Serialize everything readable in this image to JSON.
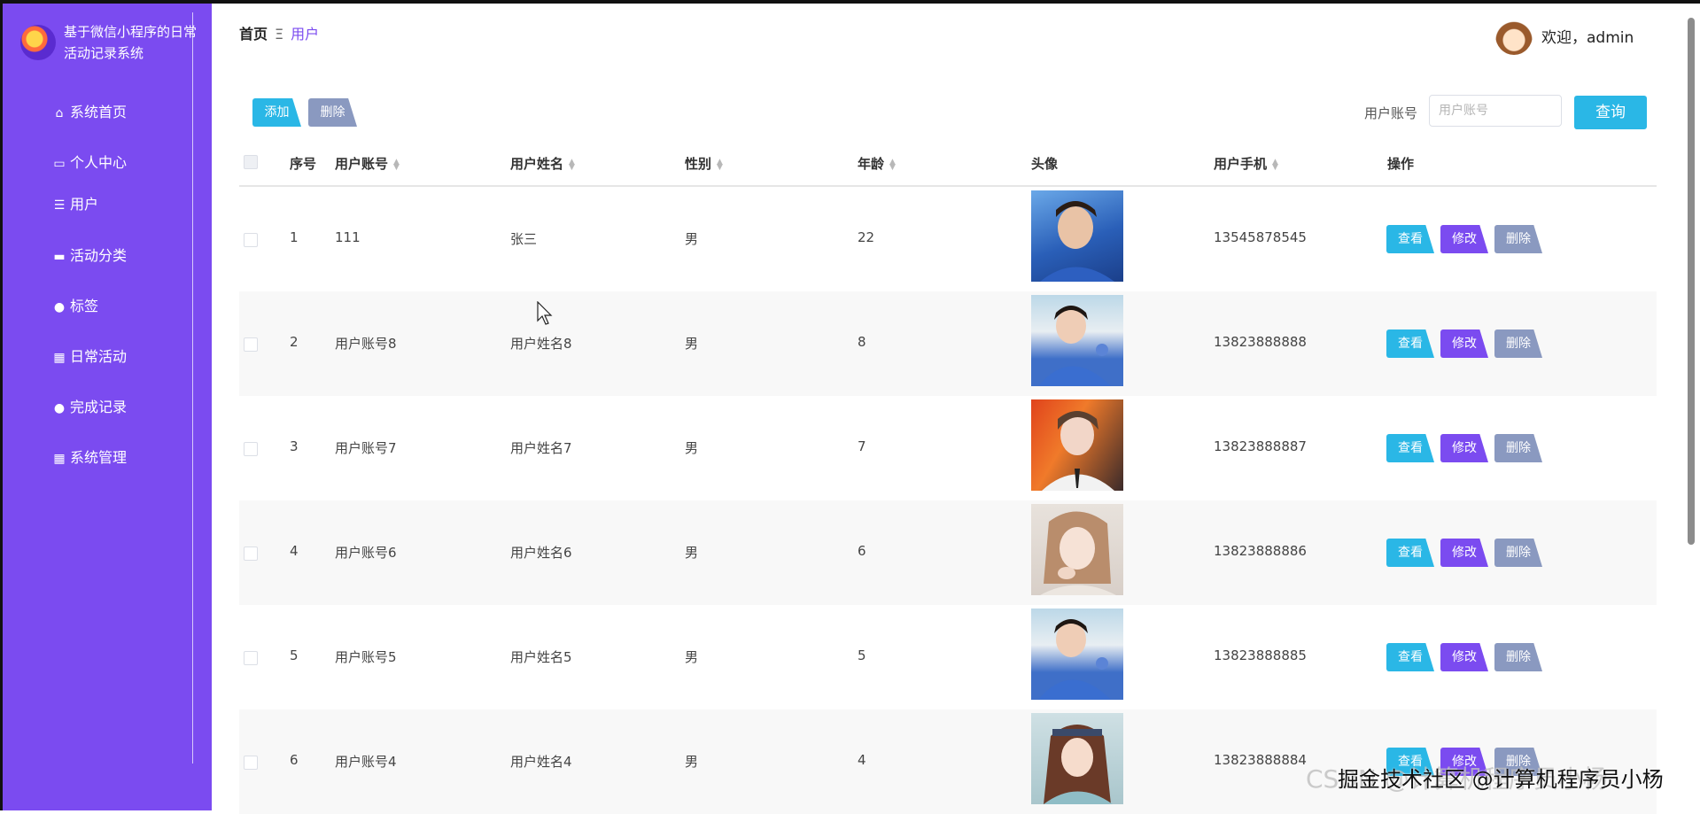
{
  "brand": {
    "title": "基于微信小程序的日常活动记录系统"
  },
  "sidebar": {
    "items": [
      {
        "label": "系统首页",
        "icon": "home-icon"
      },
      {
        "label": "个人中心",
        "icon": "card-icon"
      },
      {
        "label": "用户",
        "icon": "list-icon"
      },
      {
        "label": "活动分类",
        "icon": "monitor-icon"
      },
      {
        "label": "标签",
        "icon": "person-icon"
      },
      {
        "label": "日常活动",
        "icon": "grid-icon"
      },
      {
        "label": "完成记录",
        "icon": "user-icon"
      },
      {
        "label": "系统管理",
        "icon": "grid-icon"
      }
    ]
  },
  "breadcrumb": {
    "home": "首页",
    "sep": "Ξ",
    "current": "用户"
  },
  "header": {
    "welcome": "欢迎，admin"
  },
  "toolbar": {
    "add": "添加",
    "delete": "删除",
    "search_label": "用户账号",
    "search_placeholder": "用户账号",
    "search_button": "查询"
  },
  "table": {
    "headers": {
      "index": "序号",
      "account": "用户账号",
      "name": "用户姓名",
      "gender": "性别",
      "age": "年龄",
      "avatar": "头像",
      "phone": "用户手机",
      "ops": "操作"
    },
    "actions": {
      "view": "查看",
      "edit": "修改",
      "delete": "删除"
    },
    "rows": [
      {
        "index": "1",
        "account": "111",
        "name": "张三",
        "gender": "男",
        "age": "22",
        "phone": "13545878545"
      },
      {
        "index": "2",
        "account": "用户账号8",
        "name": "用户姓名8",
        "gender": "男",
        "age": "8",
        "phone": "13823888888"
      },
      {
        "index": "3",
        "account": "用户账号7",
        "name": "用户姓名7",
        "gender": "男",
        "age": "7",
        "phone": "13823888887"
      },
      {
        "index": "4",
        "account": "用户账号6",
        "name": "用户姓名6",
        "gender": "男",
        "age": "6",
        "phone": "13823888886"
      },
      {
        "index": "5",
        "account": "用户账号5",
        "name": "用户姓名5",
        "gender": "男",
        "age": "5",
        "phone": "13823888885"
      },
      {
        "index": "6",
        "account": "用户账号4",
        "name": "用户姓名4",
        "gender": "男",
        "age": "4",
        "phone": "13823888884"
      }
    ]
  },
  "watermark": {
    "csdn": "CSDN @计算机程序员小杨",
    "juejin": "掘金技术社区 @计算机程序员小杨"
  },
  "colors": {
    "sidebar": "#7b4bf0",
    "primary": "#2ab7e6",
    "edit": "#7b4bf0",
    "delete": "#8a99c0"
  }
}
